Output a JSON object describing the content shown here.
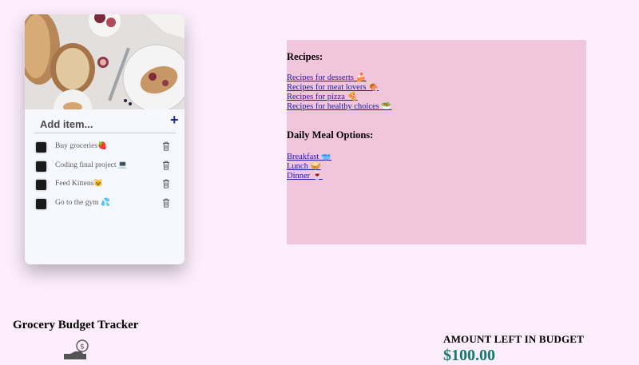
{
  "todo": {
    "input_placeholder": "Add item...",
    "add_label": "+",
    "items": [
      {
        "text": "Buy groceries🍓"
      },
      {
        "text": "Coding final project 💻"
      },
      {
        "text": "Feed Kittens😺"
      },
      {
        "text": "Go to the gym 💦"
      }
    ]
  },
  "recipes": {
    "heading": "Recipes:",
    "links": [
      " Recipes for desserts 🍰",
      "Recipes for meat lovers 🍖",
      "Recipes for pizza 🍕",
      "Recipes for healthy choices 🥗"
    ]
  },
  "meals": {
    "heading": "Daily Meal Options:",
    "links": [
      "Breakfast 🥣",
      "Lunch 🥪",
      "Dinner 🍷"
    ]
  },
  "budget": {
    "title": "Grocery Budget Tracker",
    "amount_label": "AMOUNT LEFT IN BUDGET",
    "amount_value": "$100.00"
  },
  "colors": {
    "page_bg": "#fdeefd",
    "card_bg": "#f7f8fd",
    "recipes_bg": "#f1c6dd",
    "add_button": "#1d2a9e",
    "amount": "#137a6e"
  }
}
